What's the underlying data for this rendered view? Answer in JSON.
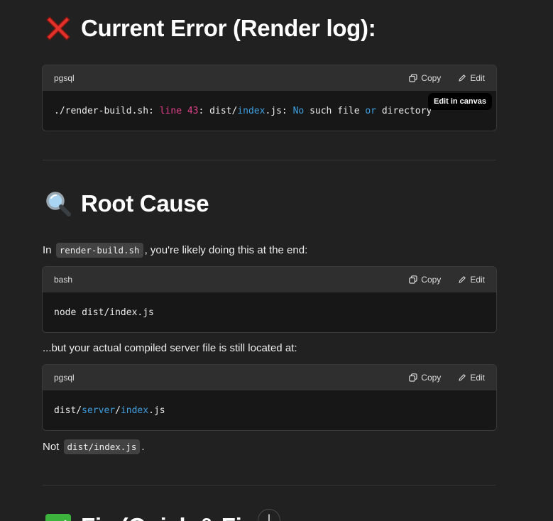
{
  "sections": {
    "error": {
      "title": "Current Error (Render log):",
      "icon": "cross-mark-icon"
    },
    "root_cause": {
      "title": "Root Cause",
      "icon": "magnifying-glass-icon"
    },
    "fix": {
      "title": "Fix (Quick & Final)",
      "icon": "check-box-icon"
    }
  },
  "code_blocks": {
    "error_log": {
      "lang": "pgsql",
      "tokens": [
        "./render-build.sh: ",
        "line 43",
        ": dist/",
        "index",
        ".js: ",
        "No",
        " such file ",
        "or",
        " directory"
      ]
    },
    "bash_cmd": {
      "lang": "bash",
      "code": "node dist/index.js"
    },
    "server_path": {
      "lang": "pgsql",
      "tokens": [
        "dist/",
        "server",
        "/",
        "index",
        ".js"
      ]
    }
  },
  "actions": {
    "copy": "Copy",
    "edit": "Edit"
  },
  "tooltip": "Edit in canvas",
  "paragraphs": {
    "p1": {
      "before": "In ",
      "code": "render-build.sh",
      "after": ", you're likely doing this at the end:"
    },
    "p2": "...but your actual compiled server file is still located at:",
    "p3": {
      "before": "Not ",
      "code": "dist/index.js",
      "after": "."
    }
  },
  "colors": {
    "background": "#212121",
    "code_header": "#2f2f2f",
    "code_body": "#171717",
    "keyword_pink": "#e3418a",
    "keyword_blue": "#3f9fe0",
    "error_red": "#e0322a",
    "check_green": "#3cb33c"
  }
}
